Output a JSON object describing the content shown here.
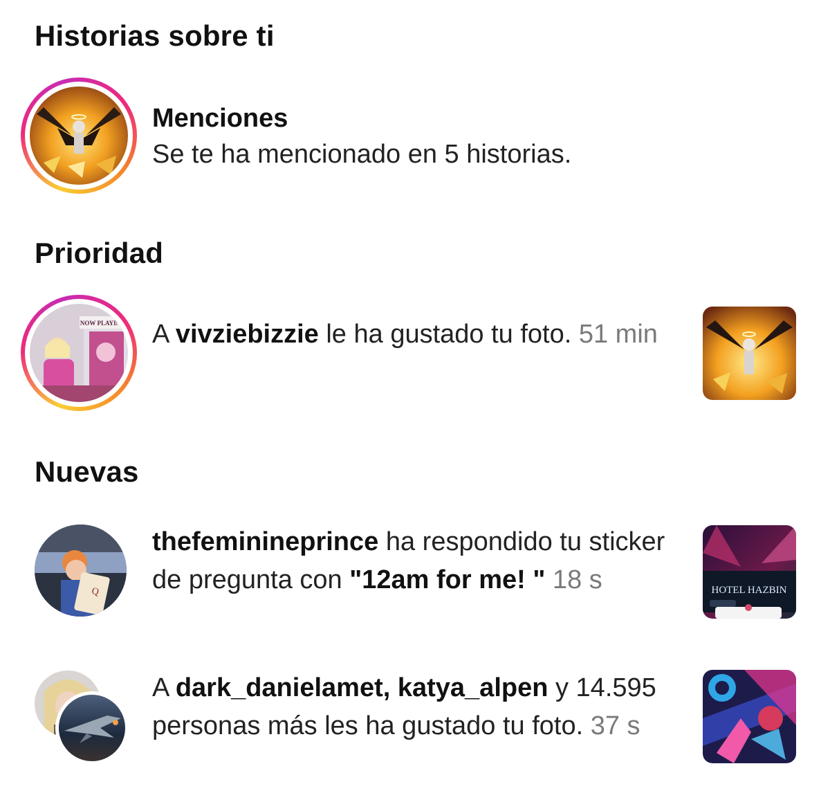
{
  "sections": {
    "stories": "Historias sobre ti",
    "priority": "Prioridad",
    "new": "Nuevas"
  },
  "mentions": {
    "title": "Menciones",
    "description": "Se te ha mencionado en 5 historias."
  },
  "priority_item": {
    "prefix": "A ",
    "user": "vivziebizzie",
    "text": " le ha gustado tu foto. ",
    "time": "51 min",
    "avatar_sign": "NOW PLAYING!"
  },
  "new_items": [
    {
      "user": "thefeminineprince",
      "text": " ha respondido tu sticker de pregunta con ",
      "quote": "\"12am for me! \"",
      "time": " 18 s",
      "thumb_title": "HOTEL HAZBIN"
    },
    {
      "prefix": "A ",
      "user1": "dark_danielamet",
      "sep": ", ",
      "user2": "katya_alpen",
      "text": " y 14.595 personas más les ha gustado tu foto. ",
      "time": "37 s"
    }
  ],
  "icons": [
    "story-ring",
    "avatar",
    "post-thumbnail"
  ],
  "colors": {
    "ring_start": "#f9ce34",
    "ring_mid": "#ee2a7b",
    "ring_end": "#c72cb3",
    "muted": "#7a7a7a"
  }
}
